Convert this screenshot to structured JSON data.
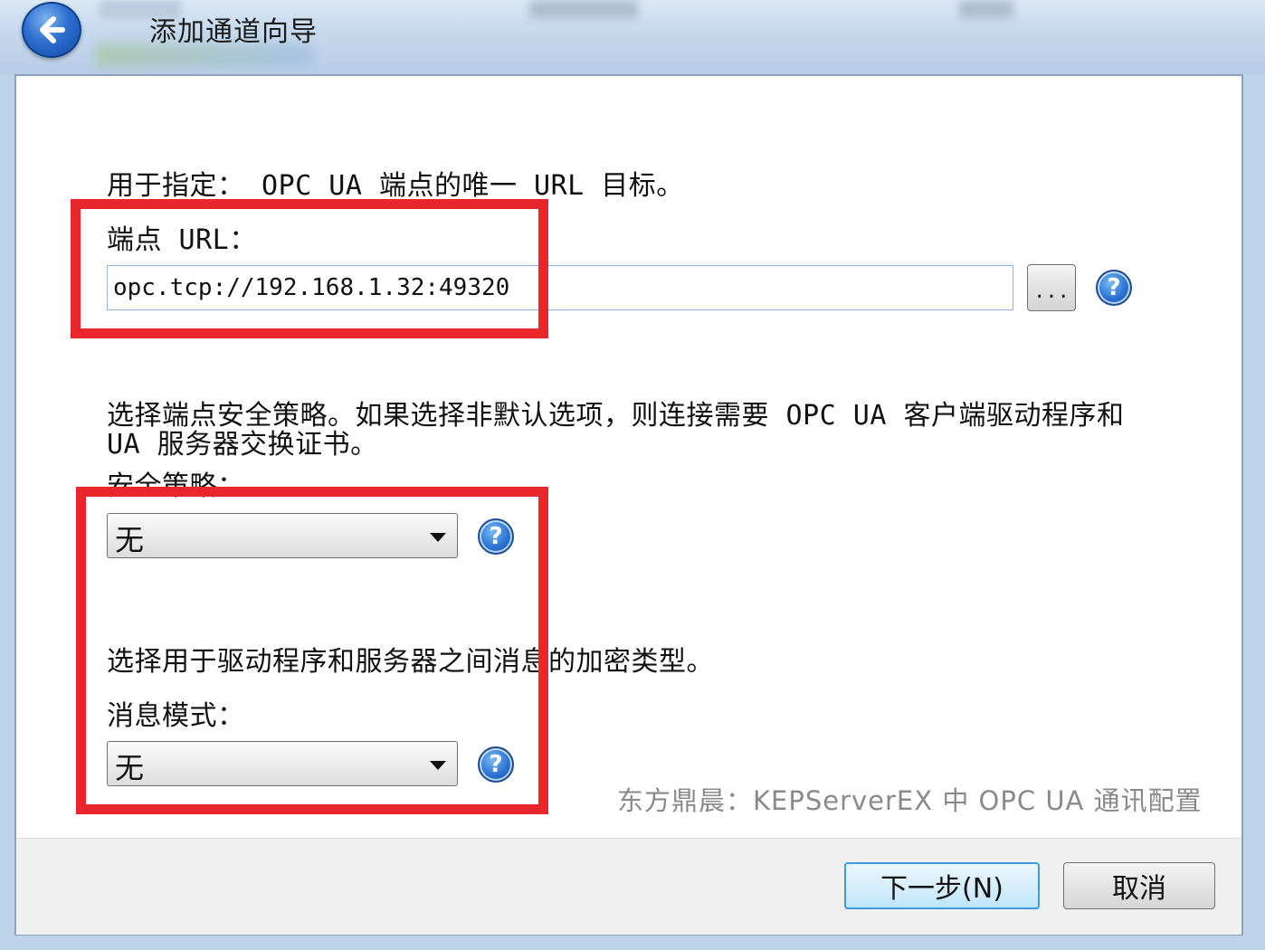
{
  "window": {
    "title": "添加通道向导"
  },
  "endpoint": {
    "description": "用于指定： OPC UA 端点的唯一 URL 目标。",
    "label": "端点 URL：",
    "url_value": "opc.tcp://192.168.1.32:49320",
    "browse_label": "..."
  },
  "security": {
    "description_line1": "选择端点安全策略。如果选择非默认选项，则连接需要 OPC UA 客户端驱动程序和",
    "description_line2": "UA 服务器交换证书。",
    "label": "安全策略：",
    "selected": "无"
  },
  "message": {
    "description": "选择用于驱动程序和服务器之间消息的加密类型。",
    "label": "消息模式：",
    "selected": "无"
  },
  "help_glyph": "?",
  "watermark": "东方鼎晨：KEPServerEX 中 OPC UA 通讯配置",
  "buttons": {
    "next": "下一步(N)",
    "cancel": "取消"
  },
  "colors": {
    "highlight": "#e8262b",
    "title_gradient_top": "#dbe8f5",
    "primary_border": "#3c9ae0"
  },
  "icons": {
    "back": "back-arrow-icon",
    "help": "help-icon",
    "dropdown": "chevron-down-icon"
  }
}
